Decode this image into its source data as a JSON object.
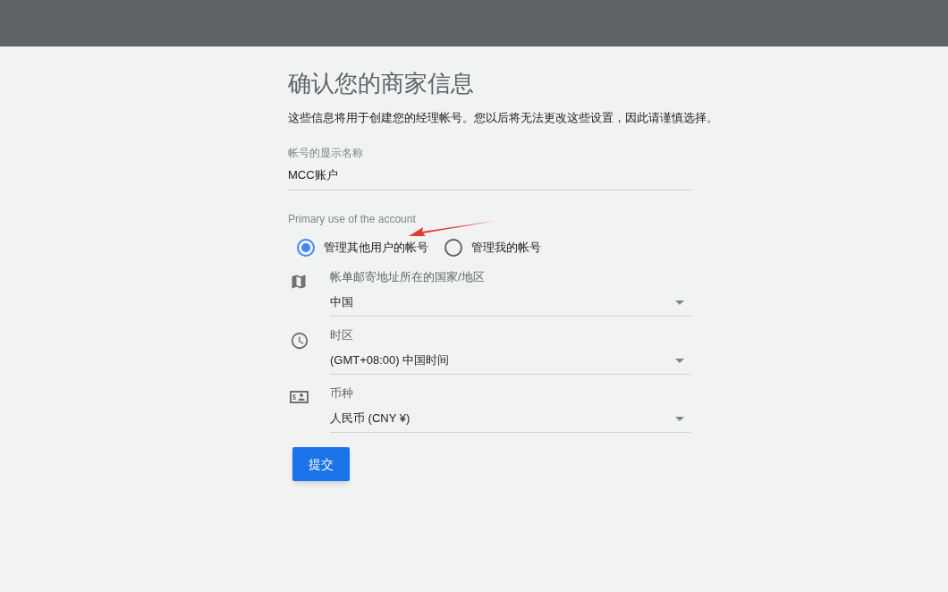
{
  "title": "确认您的商家信息",
  "description": "这些信息将用于创建您的经理帐号。您以后将无法更改这些设置，因此请谨慎选择。",
  "name_field": {
    "label": "帐号的显示名称",
    "value": "MCC账户"
  },
  "primary_use": {
    "label": "Primary use of the account",
    "options": [
      {
        "label": "管理其他用户的帐号",
        "selected": true
      },
      {
        "label": "管理我的帐号",
        "selected": false
      }
    ]
  },
  "selects": [
    {
      "kind": "map",
      "label": "帐单邮寄地址所在的国家/地区",
      "value": "中国"
    },
    {
      "kind": "clock",
      "label": "时区",
      "value": "(GMT+08:00) 中国时间"
    },
    {
      "kind": "currency",
      "label": "币种",
      "value": "人民币 (CNY ¥)"
    }
  ],
  "submit_button": "提交"
}
